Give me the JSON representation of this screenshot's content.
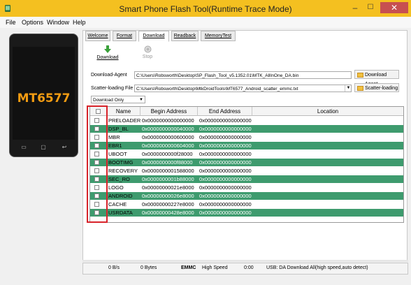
{
  "window": {
    "title": "Smart Phone Flash Tool(Runtime Trace Mode)",
    "min": "–",
    "max": "☐",
    "close": "✕"
  },
  "menu": [
    "File",
    "Options",
    "Window",
    "Help"
  ],
  "device": {
    "chip": "MT6577",
    "icons": [
      "phone-back-icon",
      "phone-home-icon",
      "phone-menu-icon"
    ]
  },
  "tabs": [
    "Welcome",
    "Format",
    "Download",
    "Readback",
    "MemoryTest"
  ],
  "active_tab": "Download",
  "toolbar": {
    "download": "Download",
    "stop": "Stop"
  },
  "download_agent": {
    "label": "Download-Agent",
    "path": "C:\\Users\\Robsworth\\Desktop\\SP_Flash_Tool_v5.1352.01\\MTK_AllInOne_DA.bin",
    "button": "Download Agent"
  },
  "scatter": {
    "label": "Scatter-loading File",
    "path": "C:\\Users\\Robsworth\\Desktop\\MtkDroidTools\\MT6577_Android_scatter_emmc.txt",
    "button": "Scatter-loading"
  },
  "mode_select": "Download Only",
  "table": {
    "columns": [
      "",
      "Name",
      "Begin Address",
      "End Address",
      "Location"
    ],
    "rows": [
      {
        "name": "PRELOADER",
        "begin": "0x0000000000000000",
        "end": "0x0000000000000000",
        "location": "",
        "checked": false
      },
      {
        "name": "DSP_BL",
        "begin": "0x0000000000040000",
        "end": "0x0000000000000000",
        "location": "",
        "checked": false
      },
      {
        "name": "MBR",
        "begin": "0x0000000000600000",
        "end": "0x0000000000000000",
        "location": "",
        "checked": false
      },
      {
        "name": "EBR1",
        "begin": "0x0000000000604000",
        "end": "0x0000000000000000",
        "location": "",
        "checked": false
      },
      {
        "name": "UBOOT",
        "begin": "0x0000000000f28000",
        "end": "0x0000000000000000",
        "location": "",
        "checked": false
      },
      {
        "name": "BOOTIMG",
        "begin": "0x0000000000f88000",
        "end": "0x0000000000000000",
        "location": "",
        "checked": false
      },
      {
        "name": "RECOVERY",
        "begin": "0x0000000001588000",
        "end": "0x0000000000000000",
        "location": "",
        "checked": false
      },
      {
        "name": "SEC_RO",
        "begin": "0x0000000001b88000",
        "end": "0x0000000000000000",
        "location": "",
        "checked": false
      },
      {
        "name": "LOGO",
        "begin": "0x00000000021e8000",
        "end": "0x0000000000000000",
        "location": "",
        "checked": false
      },
      {
        "name": "ANDROID",
        "begin": "0x00000000026e8000",
        "end": "0x0000000000000000",
        "location": "",
        "checked": false
      },
      {
        "name": "CACHE",
        "begin": "0x00000000227e8000",
        "end": "0x0000000000000000",
        "location": "",
        "checked": false
      },
      {
        "name": "USRDATA",
        "begin": "0x00000000428e8000",
        "end": "0x0000000000000000",
        "location": "",
        "checked": false
      }
    ]
  },
  "status": {
    "speed": "0 B/s",
    "bytes": "0 Bytes",
    "storage": "EMMC",
    "usb_speed": "High Speed",
    "time": "0:00",
    "message": "USB: DA Download All(high speed,auto detect)"
  },
  "colors": {
    "titlebar": "#f4c020",
    "row_highlight": "#3e9b6e",
    "annotation": "#d8232a",
    "chip_label": "#f39c12"
  }
}
